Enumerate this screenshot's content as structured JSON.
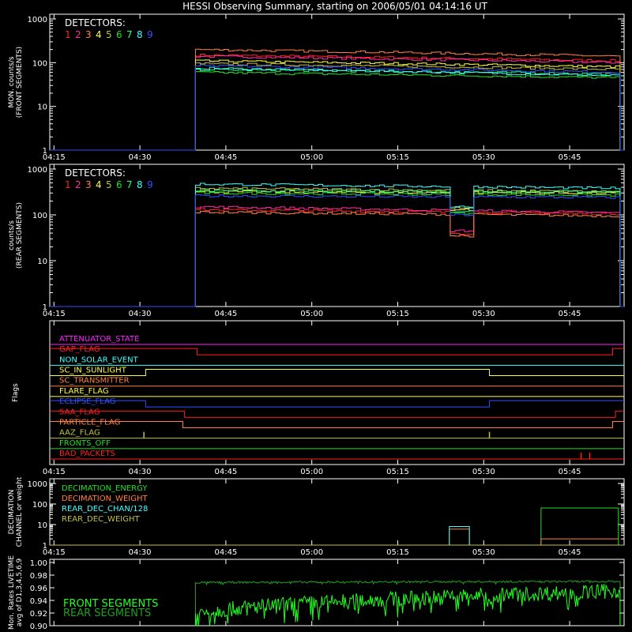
{
  "title": "HESSI Observing Summary, starting on 2006/05/01 04:14:16 UT",
  "time_ticks": [
    "04:15",
    "04:30",
    "04:45",
    "05:00",
    "05:15",
    "05:30",
    "05:45"
  ],
  "time_tick_minutes": [
    15,
    30,
    45,
    60,
    75,
    90,
    105
  ],
  "xlim_minutes": [
    14.27,
    114.5
  ],
  "colors": {
    "d1": "#ff2020",
    "d2": "#ff2ba0",
    "d3": "#ff8040",
    "d4": "#ffff40",
    "d5": "#c0c040",
    "d6": "#20e020",
    "d7": "#20ff80",
    "d8": "#40ffff",
    "d9": "#3050ff",
    "axis": "#ffffff"
  },
  "chart_data": [
    {
      "id": "front",
      "type": "line",
      "ylabel": [
        "MON. counts/s",
        "(FRONT SEGMENTS)"
      ],
      "yscale": "log",
      "ylim": [
        1,
        1000
      ],
      "yticks": [
        "1",
        "10",
        "100",
        "1000"
      ],
      "legend_title": "DETECTORS:",
      "legend_position": "top-left",
      "start_minute": 39.7,
      "end_minute": 113.8,
      "series": [
        {
          "name": "1",
          "color": "#ff2020",
          "start": 150,
          "end": 110
        },
        {
          "name": "2",
          "color": "#ff2ba0",
          "start": 140,
          "end": 100
        },
        {
          "name": "3",
          "color": "#ff8040",
          "start": 200,
          "end": 140
        },
        {
          "name": "4",
          "color": "#ffff40",
          "start": 110,
          "end": 80
        },
        {
          "name": "5",
          "color": "#c0c040",
          "start": 95,
          "end": 70
        },
        {
          "name": "6",
          "color": "#20e020",
          "start": 60,
          "end": 45
        },
        {
          "name": "7",
          "color": "#20ff80",
          "start": 70,
          "end": 55
        },
        {
          "name": "8",
          "color": "#40ffff",
          "start": 75,
          "end": 50
        },
        {
          "name": "9",
          "color": "#3050ff",
          "start": 85,
          "end": 60
        }
      ]
    },
    {
      "id": "rear",
      "type": "line",
      "ylabel": [
        "counts/s",
        "(REAR SEGMENTS)"
      ],
      "yscale": "log",
      "ylim": [
        1,
        1000
      ],
      "yticks": [
        "1",
        "10",
        "100",
        "1000"
      ],
      "legend_title": "DETECTORS:",
      "legend_position": "top-left",
      "start_minute": 39.7,
      "end_minute": 113.8,
      "dip_minutes": [
        84.0,
        87.5
      ],
      "series": [
        {
          "name": "1",
          "color": "#ff2020",
          "start": 130,
          "end": 105,
          "dip": 40
        },
        {
          "name": "2",
          "color": "#ff2ba0",
          "start": 150,
          "end": 110,
          "dip": 45
        },
        {
          "name": "3",
          "color": "#ff8040",
          "start": 115,
          "end": 95,
          "dip": 35
        },
        {
          "name": "4",
          "color": "#ffff40",
          "start": 320,
          "end": 300,
          "dip": 130
        },
        {
          "name": "5",
          "color": "#c0c040",
          "start": 380,
          "end": 320,
          "dip": 140
        },
        {
          "name": "6",
          "color": "#20e020",
          "start": 300,
          "end": 270,
          "dip": 110
        },
        {
          "name": "7",
          "color": "#20ff80",
          "start": 340,
          "end": 320,
          "dip": 120
        },
        {
          "name": "8",
          "color": "#40ffff",
          "start": 470,
          "end": 380,
          "dip": 150
        },
        {
          "name": "9",
          "color": "#3050ff",
          "start": 260,
          "end": 240,
          "dip": 100
        }
      ]
    },
    {
      "id": "flags",
      "type": "line",
      "ylabel": [
        "Flags"
      ],
      "flags": [
        {
          "name": "ATTENUATOR_STATE",
          "color": "#ff20ff",
          "segments": [
            [
              14.27,
              114.5,
              0
            ]
          ]
        },
        {
          "name": "GAP_FLAG",
          "color": "#ff2020",
          "segments": [
            [
              14.27,
              40.0,
              1
            ],
            [
              40.0,
              112.5,
              0
            ],
            [
              112.5,
              114.5,
              1
            ]
          ]
        },
        {
          "name": "NON_SOLAR_EVENT",
          "color": "#40ffff",
          "segments": [
            [
              14.27,
              114.5,
              0
            ]
          ]
        },
        {
          "name": "SC_IN_SUNLIGHT",
          "color": "#ffff40",
          "segments": [
            [
              14.27,
              31.0,
              0
            ],
            [
              31.0,
              91.0,
              1
            ],
            [
              91.0,
              114.5,
              0
            ]
          ]
        },
        {
          "name": "SC_TRANSMITTER",
          "color": "#ff8040",
          "segments": [
            [
              14.27,
              114.5,
              0
            ]
          ]
        },
        {
          "name": "FLARE_FLAG",
          "color": "#ffff40",
          "segments": [
            [
              14.27,
              114.5,
              0
            ]
          ]
        },
        {
          "name": "ECLIPSE_FLAG",
          "color": "#3050ff",
          "segments": [
            [
              14.27,
              31.0,
              1
            ],
            [
              31.0,
              91.0,
              0
            ],
            [
              91.0,
              114.5,
              1
            ]
          ]
        },
        {
          "name": "SAA_FLAG",
          "color": "#ff2020",
          "segments": [
            [
              14.27,
              37.8,
              1
            ],
            [
              37.8,
              113.0,
              0
            ],
            [
              113.0,
              114.5,
              1
            ]
          ]
        },
        {
          "name": "PARTICLE_FLAG",
          "color": "#ff8040",
          "segments": [
            [
              14.27,
              37.5,
              1
            ],
            [
              37.5,
              112.5,
              0
            ],
            [
              112.5,
              114.5,
              1
            ]
          ]
        },
        {
          "name": "AAZ_FLAG",
          "color": "#c0c040",
          "spikes": [
            30.7,
            91.0
          ],
          "segments": [
            [
              14.27,
              114.5,
              0
            ]
          ]
        },
        {
          "name": "FRONTS_OFF",
          "color": "#20e020",
          "segments": [
            [
              14.27,
              114.5,
              0
            ]
          ]
        },
        {
          "name": "BAD_PACKETS",
          "color": "#ff2020",
          "spikes": [
            107.0,
            108.5
          ],
          "segments": [
            [
              14.27,
              114.5,
              0
            ]
          ]
        }
      ]
    },
    {
      "id": "decimation",
      "type": "line",
      "ylabel": [
        "DECIMATION",
        "CHANNEL or weight"
      ],
      "yscale": "log",
      "ylim": [
        1,
        1000
      ],
      "yticks": [
        "1",
        "10",
        "100",
        "1000"
      ],
      "legend_position": "top-left",
      "series": [
        {
          "name": "DECIMATION_ENERGY",
          "color": "#20e020",
          "segments": [
            [
              14.27,
              1
            ],
            [
              100.0,
              1
            ],
            [
              100.0,
              64
            ],
            [
              113.5,
              64
            ],
            [
              113.5,
              1
            ]
          ]
        },
        {
          "name": "DECIMATION_WEIGHT",
          "color": "#ff8040",
          "segments": [
            [
              14.27,
              1
            ],
            [
              84.0,
              1
            ],
            [
              84.0,
              6
            ],
            [
              87.5,
              6
            ],
            [
              87.5,
              1
            ],
            [
              100.0,
              1
            ],
            [
              100.0,
              2
            ],
            [
              113.5,
              2
            ]
          ]
        },
        {
          "name": "REAR_DEC_CHAN/128",
          "color": "#40ffff",
          "segments": [
            [
              14.27,
              1
            ],
            [
              84.0,
              1
            ],
            [
              84.0,
              8
            ],
            [
              87.5,
              8
            ],
            [
              87.5,
              1
            ],
            [
              114.5,
              1
            ]
          ]
        },
        {
          "name": "REAR_DEC_WEIGHT",
          "color": "#c0c040",
          "segments": [
            [
              14.27,
              1
            ],
            [
              114.5,
              1
            ]
          ]
        }
      ]
    },
    {
      "id": "livetime",
      "type": "line",
      "ylabel": [
        "Mon. Rates LIVETIME",
        "avg of D1,3,4,5,6,9"
      ],
      "ylim": [
        0.9,
        1.0
      ],
      "yticks": [
        "0.90",
        "0.92",
        "0.94",
        "0.96",
        "0.98",
        "1.00"
      ],
      "legend_position": "bottom-left",
      "start_minute": 39.7,
      "end_minute": 113.8,
      "series": [
        {
          "name": "FRONT SEGMENTS",
          "color": "#20ff20",
          "start": 0.915,
          "end": 0.955,
          "noise": 0.012
        },
        {
          "name": "REAR SEGMENTS",
          "color": "#20a020",
          "start": 0.968,
          "end": 0.97,
          "noise": 0.0015
        }
      ]
    }
  ]
}
